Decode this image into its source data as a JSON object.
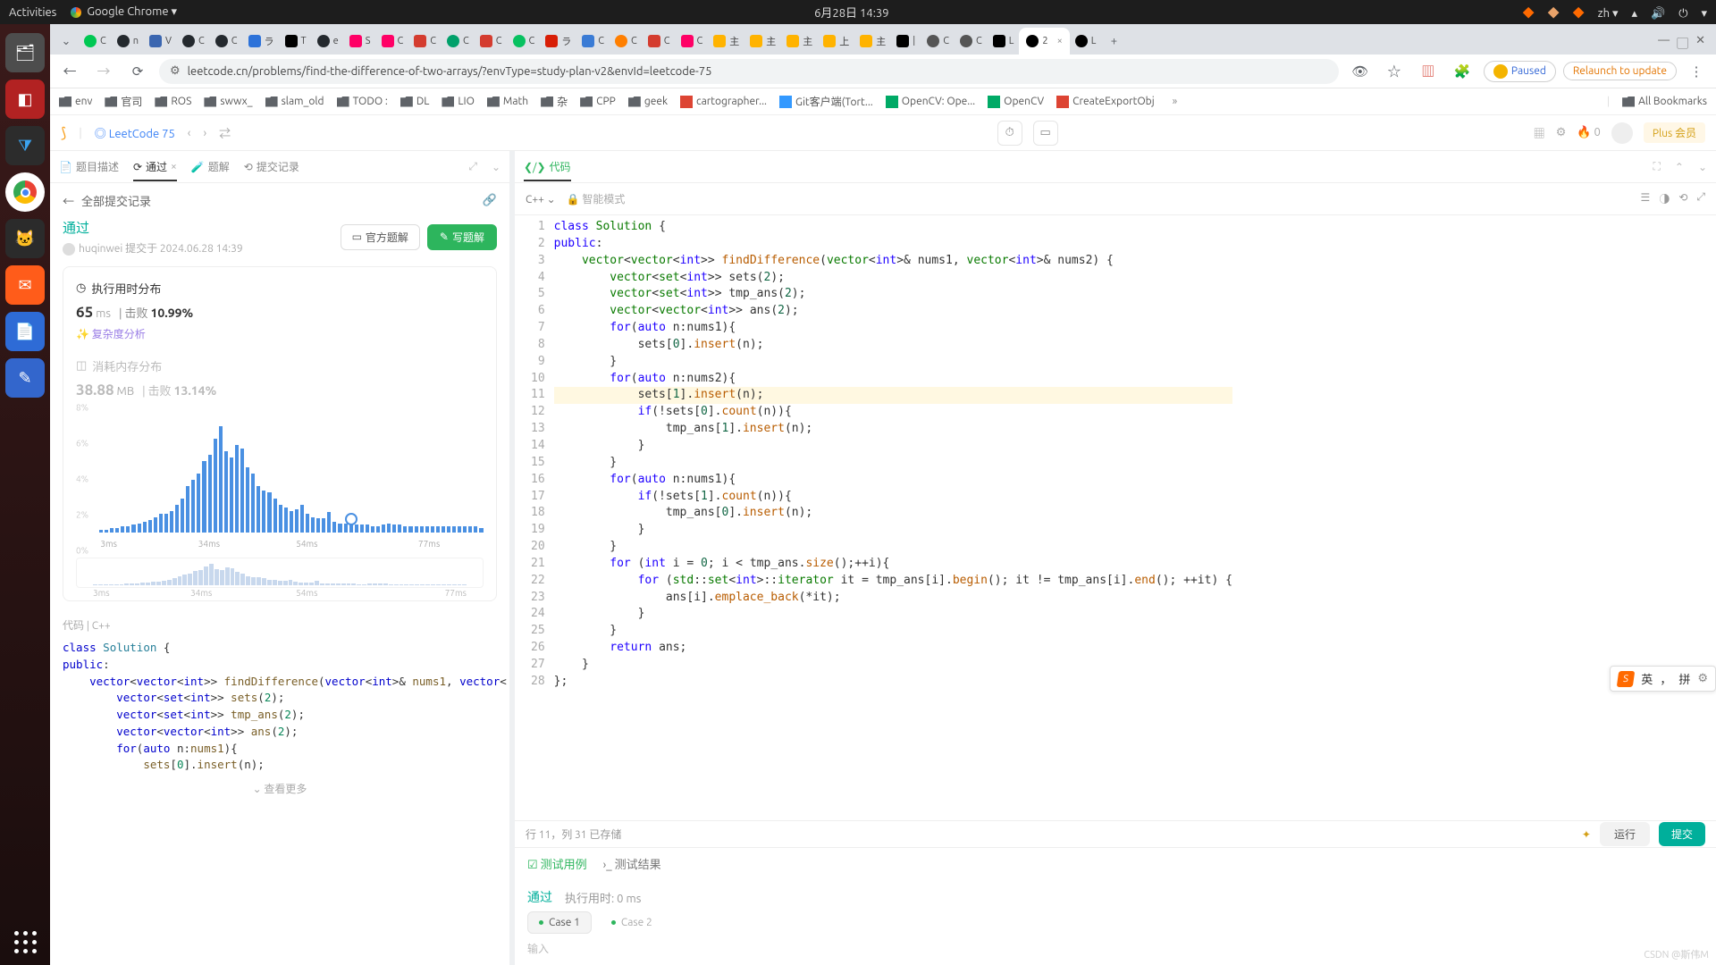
{
  "ubuntu": {
    "activities": "Activities",
    "app": "Google Chrome ▾",
    "clock": "6月28日  14:39",
    "lang": "zh ▾"
  },
  "chrome": {
    "active_tab_label": "2",
    "other_tab_label": "L",
    "url": "leetcode.cn/problems/find-the-difference-of-two-arrays/?envType=study-plan-v2&envId=leetcode-75",
    "paused": "Paused",
    "relaunch": "Relaunch to update",
    "all_bookmarks": "All Bookmarks",
    "bookmarks": [
      "env",
      "官司",
      "ROS",
      "swwx_",
      "slam_old",
      "TODO :",
      "DL",
      "LIO",
      "Math",
      "杂",
      "CPP",
      "geek",
      "cartographer...",
      "Git客户端(Tort...",
      "OpenCV: Ope...",
      "OpenCV",
      "CreateExportObj"
    ]
  },
  "lc": {
    "plan": "LeetCode 75",
    "streak": "0",
    "plus": "Plus 会员",
    "tabs": {
      "desc": "题目描述",
      "pass": "通过",
      "sol": "题解",
      "sub": "提交记录"
    },
    "back": "全部提交记录",
    "status": "通过",
    "user": "huqinwei",
    "submitted_at": "提交于 2024.06.28 14:39",
    "buttons": {
      "official": "官方题解",
      "write": "写题解"
    },
    "runtime_card": {
      "title": "执行用时分布",
      "value": "65",
      "unit": "ms",
      "beat_label": "击败",
      "beat_pct": "10.99%",
      "complexity": "✨ 复杂度分析"
    },
    "memory_card": {
      "title": "消耗内存分布",
      "value": "38.88",
      "unit": "MB",
      "beat_label": "击败",
      "beat_pct": "13.14%"
    },
    "chart": {
      "y": [
        "8%",
        "6%",
        "4%",
        "2%",
        "0%"
      ],
      "x": [
        "3ms",
        "34ms",
        "54ms",
        "77ms"
      ]
    },
    "code_tab": "代码 | C++",
    "more": "⌄ 查看更多",
    "right": {
      "code_tab": "代码",
      "lang": "C++ ⌄",
      "smart": "智能模式",
      "status": "行 11，列 31    已存储",
      "run": "运行",
      "submit": "提交",
      "test_cases": "测试用例",
      "test_results": "测试结果",
      "pass": "通过",
      "elapsed": "执行用时: 0 ms",
      "case1": "Case 1",
      "case2": "Case 2",
      "input_label": "输入"
    }
  },
  "ime": {
    "en": "英",
    "comma": "，",
    "pin": "拼"
  },
  "watermark": "CSDN @斯伟M",
  "chart_data": {
    "type": "bar",
    "title": "执行用时分布",
    "xlabel": "ms",
    "ylabel": "%",
    "ylim": [
      0,
      8
    ],
    "x_ticks": [
      "3ms",
      "34ms",
      "54ms",
      "77ms"
    ],
    "values_pct": [
      0.2,
      0.2,
      0.3,
      0.3,
      0.4,
      0.4,
      0.5,
      0.6,
      0.7,
      0.8,
      1.0,
      1.2,
      1.2,
      1.4,
      1.8,
      2.2,
      3.0,
      3.4,
      3.8,
      4.6,
      5.0,
      6.0,
      6.8,
      5.2,
      4.8,
      5.6,
      5.4,
      4.2,
      3.8,
      3.0,
      2.7,
      2.6,
      2.2,
      1.8,
      1.6,
      1.4,
      1.5,
      1.8,
      1.2,
      1.0,
      0.9,
      0.9,
      1.3,
      0.7,
      0.6,
      0.6,
      0.5,
      0.5,
      0.5,
      0.5,
      0.4,
      0.4,
      0.5,
      0.6,
      0.5,
      0.5,
      0.4,
      0.4,
      0.4,
      0.4,
      0.4,
      0.4,
      0.4,
      0.4,
      0.4,
      0.4,
      0.4,
      0.4,
      0.4,
      0.4,
      0.3
    ],
    "marker_at_ms": 65
  },
  "editor_lines": [
    "class Solution {",
    "public:",
    "    vector<vector<int>> findDifference(vector<int>& nums1, vector<int>& nums2) {",
    "        vector<set<int>> sets(2);",
    "        vector<set<int>> tmp_ans(2);",
    "        vector<vector<int>> ans(2);",
    "        for(auto n:nums1){",
    "            sets[0].insert(n);",
    "        }",
    "        for(auto n:nums2){",
    "            sets[1].insert(n);",
    "            if(!sets[0].count(n)){",
    "                tmp_ans[1].insert(n);",
    "            }",
    "        }",
    "        for(auto n:nums1){",
    "            if(!sets[1].count(n)){",
    "                tmp_ans[0].insert(n);",
    "            }",
    "        }",
    "        for (int i = 0; i < tmp_ans.size();++i){",
    "            for (std::set<int>::iterator it = tmp_ans[i].begin(); it != tmp_ans[i].end(); ++it) {",
    "                ans[i].emplace_back(*it);",
    "            }",
    "        }",
    "        return ans;",
    "    }",
    "};"
  ],
  "left_code_lines": [
    "class Solution {",
    "public:",
    "    vector<vector<int>> findDifference(vector<int>& nums1, vector<",
    "        vector<set<int>> sets(2);",
    "        vector<set<int>> tmp_ans(2);",
    "        vector<vector<int>> ans(2);",
    "        for(auto n:nums1){",
    "            sets[0].insert(n);"
  ]
}
